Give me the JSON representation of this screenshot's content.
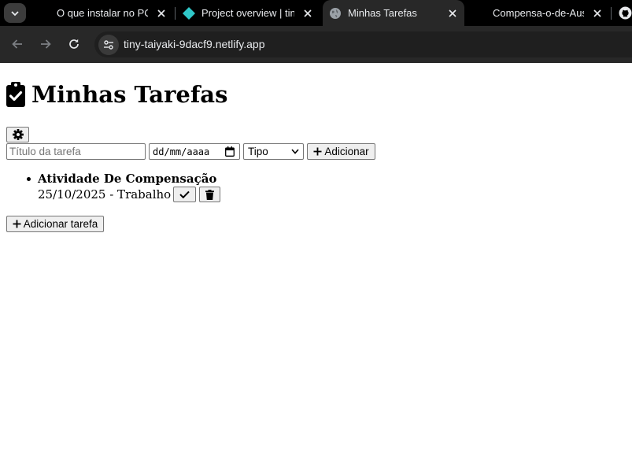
{
  "browser": {
    "tabs": [
      {
        "title": "O que instalar no PC",
        "active": false,
        "favicon": "none"
      },
      {
        "title": "Project overview | tiny-taiyaki",
        "active": false,
        "favicon": "netlify-icon"
      },
      {
        "title": "Minhas Tarefas",
        "active": true,
        "favicon": "globe-icon"
      },
      {
        "title": "Compensa-o-de-Ausencia",
        "active": false,
        "favicon": "none"
      }
    ],
    "url": "tiny-taiyaki-9dacf9.netlify.app"
  },
  "page": {
    "title": "Minhas Tarefas",
    "form": {
      "title_placeholder": "Título da tarefa",
      "date_placeholder": "dd/mm/aaaa",
      "type_selected": "Tipo",
      "add_label": "Adicionar"
    },
    "tasks": [
      {
        "title": "Atividade De Compensação",
        "meta": "25/10/2025 - Trabalho"
      }
    ],
    "add_task_label": "Adicionar tarefa"
  },
  "colors": {
    "tabstrip_bg": "#000000",
    "toolbar_bg": "#282828",
    "active_tab_bg": "#282828",
    "netlify_teal": "#30c8c9"
  }
}
